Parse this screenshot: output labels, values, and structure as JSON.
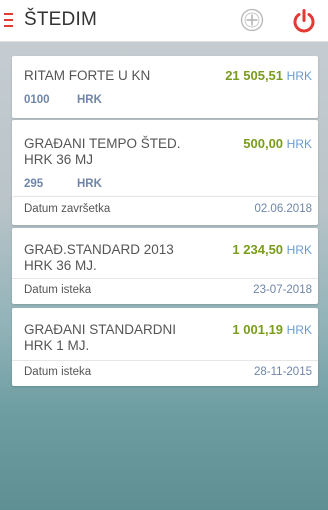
{
  "header": {
    "title": "ŠTEDIM",
    "menu_icon": "hamburger-menu-icon",
    "add_icon": "add-circle-icon",
    "power_icon": "power-icon",
    "accent_color": "#e53935"
  },
  "accounts": [
    {
      "name": "RITAM FORTE U KN",
      "amount": "21 505,51",
      "currency": "HRK",
      "code": "0100",
      "code_currency": "HRK"
    },
    {
      "name": "GRAĐANI TEMPO ŠTED. HRK 36 MJ",
      "amount": "500,00",
      "currency": "HRK",
      "code": "295",
      "code_currency": "HRK",
      "date_label": "Datum završetka",
      "date": "02.06.2018"
    },
    {
      "name": "GRAĐ.STANDARD 2013 HRK  36 MJ.",
      "amount": "1 234,50",
      "currency": "HRK",
      "date_label": "Datum isteka",
      "date": "23-07-2018"
    },
    {
      "name": "GRAĐANI STANDARDNI HRK 1 MJ.",
      "amount": "1 001,19",
      "currency": "HRK",
      "date_label": "Datum isteka",
      "date": "28-11-2015"
    }
  ]
}
